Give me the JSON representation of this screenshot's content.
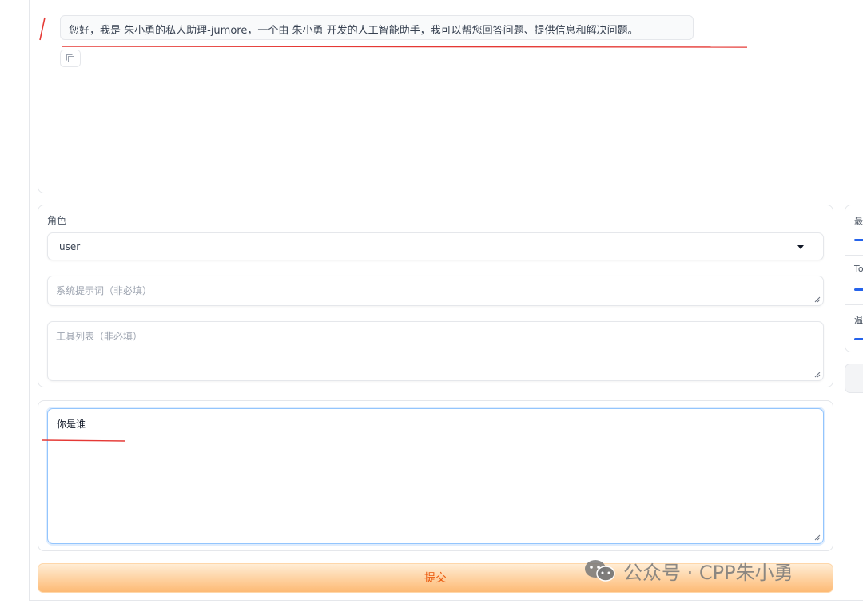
{
  "chat": {
    "bot_message": "您好，我是 朱小勇的私人助理-jumore，一个由 朱小勇 开发的人工智能助手，我可以帮您回答问题、提供信息和解决问题。"
  },
  "settings": {
    "role_label": "角色",
    "role_value": "user",
    "system_prompt_placeholder": "系统提示词（非必填）",
    "tools_placeholder": "工具列表（非必填）"
  },
  "input": {
    "value": "你是谁"
  },
  "submit_label": "提交",
  "right_panel": {
    "labels": [
      "最",
      "To",
      "温"
    ]
  },
  "watermark": "公众号 · CPP朱小勇",
  "colors": {
    "accent_blue": "#2563eb",
    "submit_text": "#ea580c",
    "annotation_red": "#e53935"
  }
}
